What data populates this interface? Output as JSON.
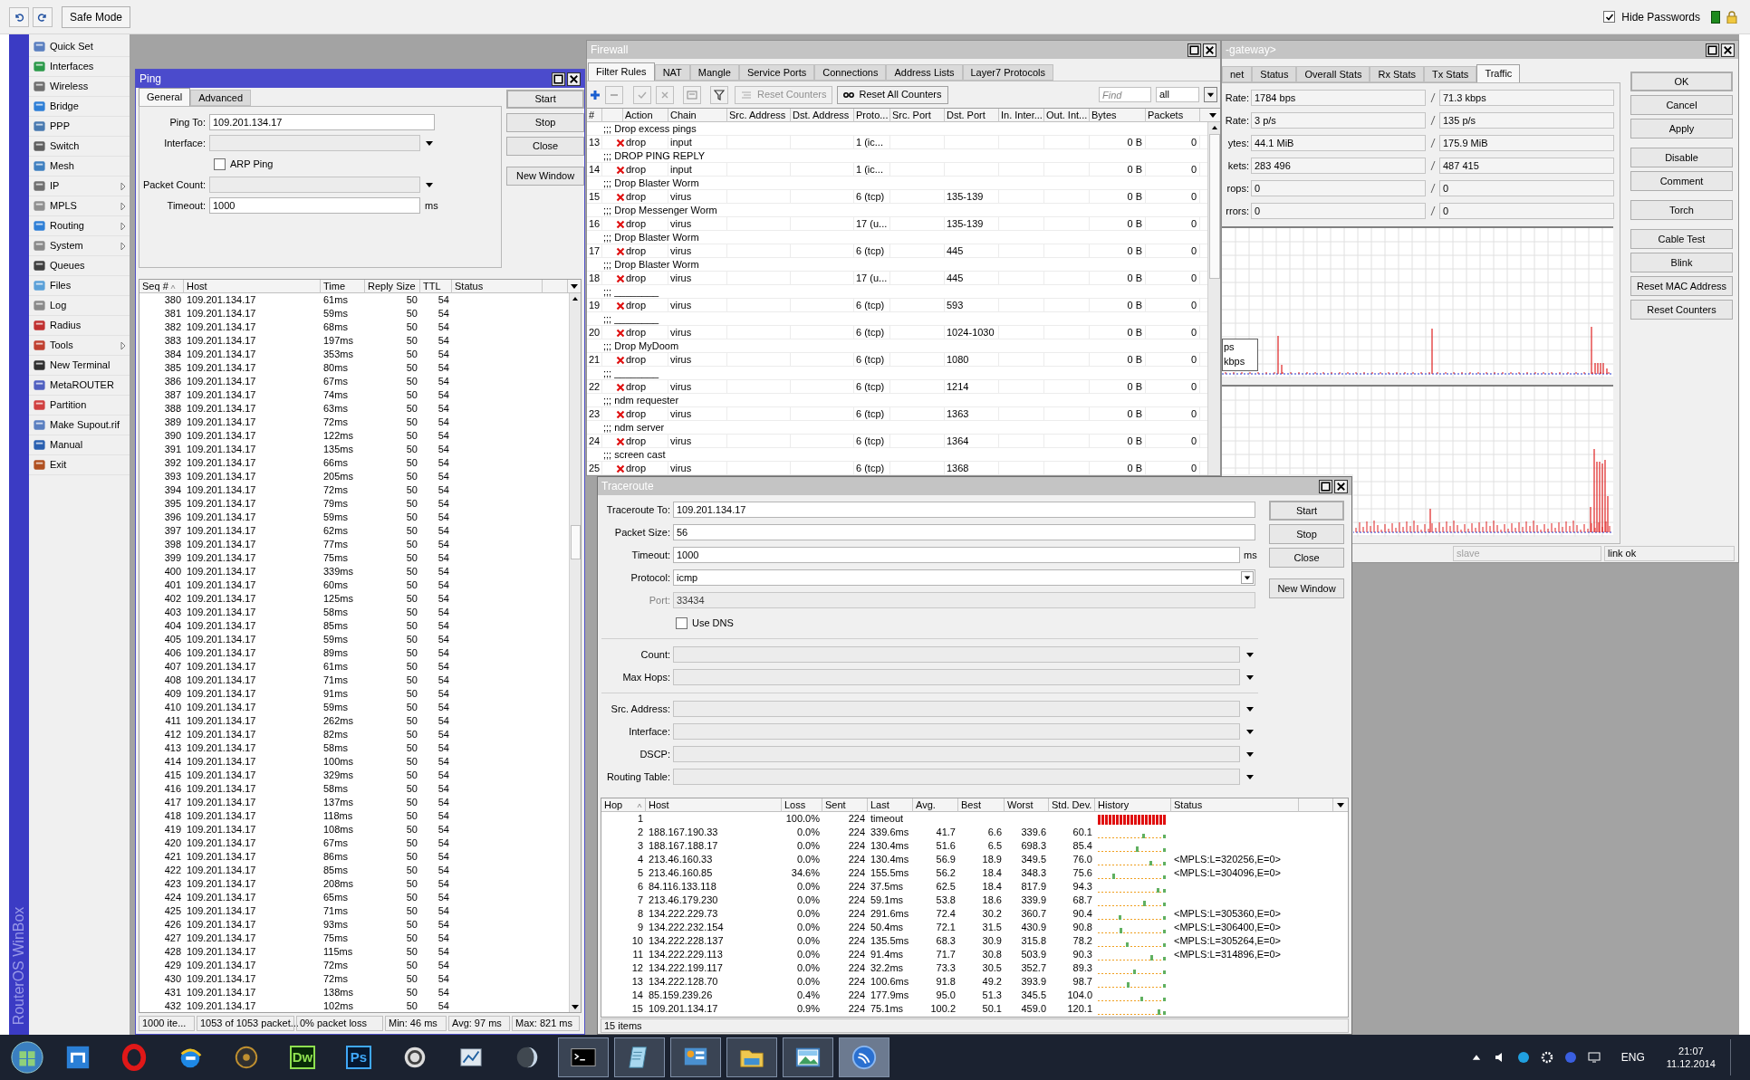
{
  "toolbar": {
    "safe_mode": "Safe Mode",
    "hide_passwords": {
      "label": "Hide Passwords",
      "checked": true
    }
  },
  "sidebar": {
    "brand": "RouterOS WinBox",
    "items": [
      {
        "label": "Quick Set",
        "submenu": false
      },
      {
        "label": "Interfaces",
        "submenu": false
      },
      {
        "label": "Wireless",
        "submenu": false
      },
      {
        "label": "Bridge",
        "submenu": false
      },
      {
        "label": "PPP",
        "submenu": false
      },
      {
        "label": "Switch",
        "submenu": false
      },
      {
        "label": "Mesh",
        "submenu": false
      },
      {
        "label": "IP",
        "submenu": true
      },
      {
        "label": "MPLS",
        "submenu": true
      },
      {
        "label": "Routing",
        "submenu": true
      },
      {
        "label": "System",
        "submenu": true
      },
      {
        "label": "Queues",
        "submenu": false
      },
      {
        "label": "Files",
        "submenu": false
      },
      {
        "label": "Log",
        "submenu": false
      },
      {
        "label": "Radius",
        "submenu": false
      },
      {
        "label": "Tools",
        "submenu": true
      },
      {
        "label": "New Terminal",
        "submenu": false
      },
      {
        "label": "MetaROUTER",
        "submenu": false
      },
      {
        "label": "Partition",
        "submenu": false
      },
      {
        "label": "Make Supout.rif",
        "submenu": false
      },
      {
        "label": "Manual",
        "submenu": false
      },
      {
        "label": "Exit",
        "submenu": false
      }
    ]
  },
  "ping": {
    "title": "Ping",
    "tabs": [
      {
        "label": "General",
        "selected": true
      },
      {
        "label": "Advanced",
        "selected": false
      }
    ],
    "fields": [
      {
        "kind": "text",
        "label": "Ping To:",
        "value": "109.201.134.17"
      },
      {
        "kind": "dropdown",
        "label": "Interface:"
      },
      {
        "kind": "checkbox",
        "label": "ARP Ping",
        "checked": false
      },
      {
        "kind": "dropdown",
        "label": "Packet Count:"
      },
      {
        "kind": "text",
        "label": "Timeout:",
        "value": "1000",
        "unit": "ms"
      }
    ],
    "buttons": [
      "Start",
      "Stop",
      "Close",
      "New Window"
    ],
    "table": {
      "columns": [
        "Seq #",
        "Host",
        "Time",
        "Reply Size",
        "TTL",
        "Status"
      ],
      "rows": [
        [
          "380",
          "109.201.134.17",
          "61ms",
          "50",
          "54"
        ],
        [
          "381",
          "109.201.134.17",
          "59ms",
          "50",
          "54"
        ],
        [
          "382",
          "109.201.134.17",
          "68ms",
          "50",
          "54"
        ],
        [
          "383",
          "109.201.134.17",
          "197ms",
          "50",
          "54"
        ],
        [
          "384",
          "109.201.134.17",
          "353ms",
          "50",
          "54"
        ],
        [
          "385",
          "109.201.134.17",
          "80ms",
          "50",
          "54"
        ],
        [
          "386",
          "109.201.134.17",
          "67ms",
          "50",
          "54"
        ],
        [
          "387",
          "109.201.134.17",
          "74ms",
          "50",
          "54"
        ],
        [
          "388",
          "109.201.134.17",
          "63ms",
          "50",
          "54"
        ],
        [
          "389",
          "109.201.134.17",
          "72ms",
          "50",
          "54"
        ],
        [
          "390",
          "109.201.134.17",
          "122ms",
          "50",
          "54"
        ],
        [
          "391",
          "109.201.134.17",
          "135ms",
          "50",
          "54"
        ],
        [
          "392",
          "109.201.134.17",
          "66ms",
          "50",
          "54"
        ],
        [
          "393",
          "109.201.134.17",
          "205ms",
          "50",
          "54"
        ],
        [
          "394",
          "109.201.134.17",
          "72ms",
          "50",
          "54"
        ],
        [
          "395",
          "109.201.134.17",
          "79ms",
          "50",
          "54"
        ],
        [
          "396",
          "109.201.134.17",
          "59ms",
          "50",
          "54"
        ],
        [
          "397",
          "109.201.134.17",
          "62ms",
          "50",
          "54"
        ],
        [
          "398",
          "109.201.134.17",
          "77ms",
          "50",
          "54"
        ],
        [
          "399",
          "109.201.134.17",
          "75ms",
          "50",
          "54"
        ],
        [
          "400",
          "109.201.134.17",
          "339ms",
          "50",
          "54"
        ],
        [
          "401",
          "109.201.134.17",
          "60ms",
          "50",
          "54"
        ],
        [
          "402",
          "109.201.134.17",
          "125ms",
          "50",
          "54"
        ],
        [
          "403",
          "109.201.134.17",
          "58ms",
          "50",
          "54"
        ],
        [
          "404",
          "109.201.134.17",
          "85ms",
          "50",
          "54"
        ],
        [
          "405",
          "109.201.134.17",
          "59ms",
          "50",
          "54"
        ],
        [
          "406",
          "109.201.134.17",
          "89ms",
          "50",
          "54"
        ],
        [
          "407",
          "109.201.134.17",
          "61ms",
          "50",
          "54"
        ],
        [
          "408",
          "109.201.134.17",
          "71ms",
          "50",
          "54"
        ],
        [
          "409",
          "109.201.134.17",
          "91ms",
          "50",
          "54"
        ],
        [
          "410",
          "109.201.134.17",
          "59ms",
          "50",
          "54"
        ],
        [
          "411",
          "109.201.134.17",
          "262ms",
          "50",
          "54"
        ],
        [
          "412",
          "109.201.134.17",
          "82ms",
          "50",
          "54"
        ],
        [
          "413",
          "109.201.134.17",
          "58ms",
          "50",
          "54"
        ],
        [
          "414",
          "109.201.134.17",
          "100ms",
          "50",
          "54"
        ],
        [
          "415",
          "109.201.134.17",
          "329ms",
          "50",
          "54"
        ],
        [
          "416",
          "109.201.134.17",
          "58ms",
          "50",
          "54"
        ],
        [
          "417",
          "109.201.134.17",
          "137ms",
          "50",
          "54"
        ],
        [
          "418",
          "109.201.134.17",
          "118ms",
          "50",
          "54"
        ],
        [
          "419",
          "109.201.134.17",
          "108ms",
          "50",
          "54"
        ],
        [
          "420",
          "109.201.134.17",
          "67ms",
          "50",
          "54"
        ],
        [
          "421",
          "109.201.134.17",
          "86ms",
          "50",
          "54"
        ],
        [
          "422",
          "109.201.134.17",
          "85ms",
          "50",
          "54"
        ],
        [
          "423",
          "109.201.134.17",
          "208ms",
          "50",
          "54"
        ],
        [
          "424",
          "109.201.134.17",
          "65ms",
          "50",
          "54"
        ],
        [
          "425",
          "109.201.134.17",
          "71ms",
          "50",
          "54"
        ],
        [
          "426",
          "109.201.134.17",
          "93ms",
          "50",
          "54"
        ],
        [
          "427",
          "109.201.134.17",
          "75ms",
          "50",
          "54"
        ],
        [
          "428",
          "109.201.134.17",
          "115ms",
          "50",
          "54"
        ],
        [
          "429",
          "109.201.134.17",
          "72ms",
          "50",
          "54"
        ],
        [
          "430",
          "109.201.134.17",
          "72ms",
          "50",
          "54"
        ],
        [
          "431",
          "109.201.134.17",
          "138ms",
          "50",
          "54"
        ],
        [
          "432",
          "109.201.134.17",
          "102ms",
          "50",
          "54"
        ]
      ]
    },
    "status_bar": [
      "1000 ite...",
      "1053 of 1053 packet...",
      "0% packet loss",
      "Min: 46 ms",
      "Avg: 97 ms",
      "Max: 821 ms"
    ]
  },
  "firewall": {
    "title": "Firewall",
    "tabs": [
      {
        "label": "Filter Rules",
        "selected": true
      },
      {
        "label": "NAT",
        "selected": false
      },
      {
        "label": "Mangle",
        "selected": false
      },
      {
        "label": "Service Ports",
        "selected": false
      },
      {
        "label": "Connections",
        "selected": false
      },
      {
        "label": "Address Lists",
        "selected": false
      },
      {
        "label": "Layer7 Protocols",
        "selected": false
      }
    ],
    "toolbar": {
      "reset_counters": "Reset Counters",
      "reset_all_counters": "Reset All Counters",
      "find_placeholder": "Find",
      "filter": "all"
    },
    "columns": [
      "#",
      "Action",
      "Chain",
      "Src. Address",
      "Dst. Address",
      "Proto...",
      "Src. Port",
      "Dst. Port",
      "In. Inter...",
      "Out. Int...",
      "Bytes",
      "Packets"
    ],
    "rules": [
      {
        "comment": ";;; Drop excess pings",
        "number": "13",
        "action": "drop",
        "chain": "input",
        "protocol": "1 (ic...",
        "bytes": "0 B",
        "packets": "0"
      },
      {
        "comment": ";;; DROP PING REPLY",
        "number": "14",
        "action": "drop",
        "chain": "input",
        "protocol": "1 (ic...",
        "bytes": "0 B",
        "packets": "0"
      },
      {
        "comment": ";;; Drop Blaster Worm",
        "number": "15",
        "action": "drop",
        "chain": "virus",
        "protocol": "6 (tcp)",
        "dst_port": "135-139",
        "bytes": "0 B",
        "packets": "0"
      },
      {
        "comment": ";;; Drop Messenger Worm",
        "number": "16",
        "action": "drop",
        "chain": "virus",
        "protocol": "17 (u...",
        "dst_port": "135-139",
        "bytes": "0 B",
        "packets": "0"
      },
      {
        "comment": ";;; Drop Blaster Worm",
        "number": "17",
        "action": "drop",
        "chain": "virus",
        "protocol": "6 (tcp)",
        "dst_port": "445",
        "bytes": "0 B",
        "packets": "0"
      },
      {
        "comment": ";;; Drop Blaster Worm",
        "number": "18",
        "action": "drop",
        "chain": "virus",
        "protocol": "17 (u...",
        "dst_port": "445",
        "bytes": "0 B",
        "packets": "0"
      },
      {
        "comment": ";;; ________",
        "number": "19",
        "action": "drop",
        "chain": "virus",
        "protocol": "6 (tcp)",
        "dst_port": "593",
        "bytes": "0 B",
        "packets": "0"
      },
      {
        "comment": ";;; ________",
        "number": "20",
        "action": "drop",
        "chain": "virus",
        "protocol": "6 (tcp)",
        "dst_port": "1024-1030",
        "bytes": "0 B",
        "packets": "0"
      },
      {
        "comment": ";;; Drop MyDoom",
        "number": "21",
        "action": "drop",
        "chain": "virus",
        "protocol": "6 (tcp)",
        "dst_port": "1080",
        "bytes": "0 B",
        "packets": "0"
      },
      {
        "comment": ";;; ________",
        "number": "22",
        "action": "drop",
        "chain": "virus",
        "protocol": "6 (tcp)",
        "dst_port": "1214",
        "bytes": "0 B",
        "packets": "0"
      },
      {
        "comment": ";;; ndm requester",
        "number": "23",
        "action": "drop",
        "chain": "virus",
        "protocol": "6 (tcp)",
        "dst_port": "1363",
        "bytes": "0 B",
        "packets": "0"
      },
      {
        "comment": ";;; ndm server",
        "number": "24",
        "action": "drop",
        "chain": "virus",
        "protocol": "6 (tcp)",
        "dst_port": "1364",
        "bytes": "0 B",
        "packets": "0"
      },
      {
        "comment": ";;; screen cast",
        "number": "25",
        "action": "drop",
        "chain": "virus",
        "protocol": "6 (tcp)",
        "dst_port": "1368",
        "bytes": "0 B",
        "packets": "0"
      }
    ]
  },
  "interface": {
    "title": "-gateway>",
    "tabs": [
      {
        "label": "net",
        "selected": false
      },
      {
        "label": "Status",
        "selected": false
      },
      {
        "label": "Overall Stats",
        "selected": false
      },
      {
        "label": "Rx Stats",
        "selected": false
      },
      {
        "label": "Tx Stats",
        "selected": false
      },
      {
        "label": "Traffic",
        "selected": true
      }
    ],
    "stats": [
      {
        "label": "Rate:",
        "rx": "1784 bps",
        "tx": "71.3 kbps"
      },
      {
        "label": "Rate:",
        "rx": "3 p/s",
        "tx": "135 p/s"
      },
      {
        "label": "ytes:",
        "rx": "44.1 MiB",
        "tx": "175.9 MiB"
      },
      {
        "label": "kets:",
        "rx": "283 496",
        "tx": "487 415"
      },
      {
        "label": "rops:",
        "rx": "0",
        "tx": "0"
      },
      {
        "label": "rrors:",
        "rx": "0",
        "tx": "0"
      }
    ],
    "legend": [
      "ps",
      "kbps"
    ],
    "buttons": [
      "OK",
      "Cancel",
      "Apply",
      "Disable",
      "Comment",
      "Torch",
      "Cable Test",
      "Blink",
      "Reset MAC Address",
      "Reset Counters"
    ],
    "status_bar": [
      "slave",
      "link ok"
    ]
  },
  "traceroute": {
    "title": "Traceroute",
    "fields": [
      {
        "kind": "text",
        "label": "Traceroute To:",
        "value": "109.201.134.17"
      },
      {
        "kind": "text",
        "label": "Packet Size:",
        "value": "56"
      },
      {
        "kind": "text",
        "label": "Timeout:",
        "value": "1000",
        "unit": "ms"
      },
      {
        "kind": "select",
        "label": "Protocol:",
        "value": "icmp"
      },
      {
        "kind": "disabled",
        "label": "Port:",
        "value": "33434"
      },
      {
        "kind": "checkbox",
        "label": "Use DNS",
        "checked": false
      },
      {
        "kind": "separator"
      },
      {
        "kind": "dropdown",
        "label": "Count:"
      },
      {
        "kind": "dropdown",
        "label": "Max Hops:"
      },
      {
        "kind": "separator"
      },
      {
        "kind": "dropdown",
        "label": "Src. Address:"
      },
      {
        "kind": "dropdown",
        "label": "Interface:"
      },
      {
        "kind": "dropdown",
        "label": "DSCP:"
      },
      {
        "kind": "dropdown",
        "label": "Routing Table:"
      }
    ],
    "buttons": [
      "Start",
      "Stop",
      "Close",
      "New Window"
    ],
    "columns": [
      "Hop",
      "Host",
      "Loss",
      "Sent",
      "Last",
      "Avg.",
      "Best",
      "Worst",
      "Std. Dev.",
      "History",
      "Status"
    ],
    "rows": [
      {
        "hop": "1",
        "loss": "100.0%",
        "sent": "224",
        "last": "timeout",
        "timed_out": true
      },
      {
        "hop": "2",
        "host": "188.167.190.33",
        "loss": "0.0%",
        "sent": "224",
        "last": "339.6ms",
        "avg": "41.7",
        "best": "6.6",
        "worst": "339.6",
        "std_dev": "60.1",
        "timed_out": false
      },
      {
        "hop": "3",
        "host": "188.167.188.17",
        "loss": "0.0%",
        "sent": "224",
        "last": "130.4ms",
        "avg": "51.6",
        "best": "6.5",
        "worst": "698.3",
        "std_dev": "85.4",
        "timed_out": false
      },
      {
        "hop": "4",
        "host": "213.46.160.33",
        "loss": "0.0%",
        "sent": "224",
        "last": "130.4ms",
        "avg": "56.9",
        "best": "18.9",
        "worst": "349.5",
        "std_dev": "76.0",
        "timed_out": false,
        "status": "<MPLS:L=320256,E=0>"
      },
      {
        "hop": "5",
        "host": "213.46.160.85",
        "loss": "34.6%",
        "sent": "224",
        "last": "155.5ms",
        "avg": "56.2",
        "best": "18.4",
        "worst": "348.3",
        "std_dev": "75.6",
        "timed_out": false,
        "status": "<MPLS:L=304096,E=0>"
      },
      {
        "hop": "6",
        "host": "84.116.133.118",
        "loss": "0.0%",
        "sent": "224",
        "last": "37.5ms",
        "avg": "62.5",
        "best": "18.4",
        "worst": "817.9",
        "std_dev": "94.3",
        "timed_out": false
      },
      {
        "hop": "7",
        "host": "213.46.179.230",
        "loss": "0.0%",
        "sent": "224",
        "last": "59.1ms",
        "avg": "53.8",
        "best": "18.6",
        "worst": "339.9",
        "std_dev": "68.7",
        "timed_out": false
      },
      {
        "hop": "8",
        "host": "134.222.229.73",
        "loss": "0.0%",
        "sent": "224",
        "last": "291.6ms",
        "avg": "72.4",
        "best": "30.2",
        "worst": "360.7",
        "std_dev": "90.4",
        "timed_out": false,
        "status": "<MPLS:L=305360,E=0>"
      },
      {
        "hop": "9",
        "host": "134.222.232.154",
        "loss": "0.0%",
        "sent": "224",
        "last": "50.4ms",
        "avg": "72.1",
        "best": "31.5",
        "worst": "430.9",
        "std_dev": "90.8",
        "timed_out": false,
        "status": "<MPLS:L=306400,E=0>"
      },
      {
        "hop": "10",
        "host": "134.222.228.137",
        "loss": "0.0%",
        "sent": "224",
        "last": "135.5ms",
        "avg": "68.3",
        "best": "30.9",
        "worst": "315.8",
        "std_dev": "78.2",
        "timed_out": false,
        "status": "<MPLS:L=305264,E=0>"
      },
      {
        "hop": "11",
        "host": "134.222.229.113",
        "loss": "0.0%",
        "sent": "224",
        "last": "91.4ms",
        "avg": "71.7",
        "best": "30.8",
        "worst": "503.9",
        "std_dev": "90.3",
        "timed_out": false,
        "status": "<MPLS:L=314896,E=0>"
      },
      {
        "hop": "12",
        "host": "134.222.199.117",
        "loss": "0.0%",
        "sent": "224",
        "last": "32.2ms",
        "avg": "73.3",
        "best": "30.5",
        "worst": "352.7",
        "std_dev": "89.3",
        "timed_out": false
      },
      {
        "hop": "13",
        "host": "134.222.128.70",
        "loss": "0.0%",
        "sent": "224",
        "last": "100.6ms",
        "avg": "91.8",
        "best": "49.2",
        "worst": "393.9",
        "std_dev": "98.7",
        "timed_out": false
      },
      {
        "hop": "14",
        "host": "85.159.239.26",
        "loss": "0.4%",
        "sent": "224",
        "last": "177.9ms",
        "avg": "95.0",
        "best": "51.3",
        "worst": "345.5",
        "std_dev": "104.0",
        "timed_out": false
      },
      {
        "hop": "15",
        "host": "109.201.134.17",
        "loss": "0.9%",
        "sent": "224",
        "last": "75.1ms",
        "avg": "100.2",
        "best": "50.1",
        "worst": "459.0",
        "std_dev": "120.1",
        "timed_out": false
      }
    ],
    "status_bar": "15 items"
  },
  "taskbar": {
    "apps": [
      {
        "kind": "orb",
        "running": false
      },
      {
        "kind": "tile",
        "running": false
      },
      {
        "kind": "ring",
        "running": false
      },
      {
        "kind": "globe",
        "running": false
      },
      {
        "kind": "disc",
        "running": false
      },
      {
        "kind": "label",
        "label": "Dw",
        "running": false
      },
      {
        "kind": "label",
        "label": "Ps",
        "running": false
      },
      {
        "kind": "spiral",
        "running": false
      },
      {
        "kind": "chart",
        "running": false
      },
      {
        "kind": "halfmoon",
        "running": false
      },
      {
        "kind": "terminal",
        "running": true
      },
      {
        "kind": "note",
        "running": true
      },
      {
        "kind": "panel",
        "running": true
      },
      {
        "kind": "folder",
        "running": true
      },
      {
        "kind": "photo",
        "running": true
      },
      {
        "kind": "wave",
        "running": true,
        "active": true
      }
    ],
    "tray": {
      "language": "ENG",
      "time": "21:07",
      "date": "11.12.2014"
    }
  }
}
